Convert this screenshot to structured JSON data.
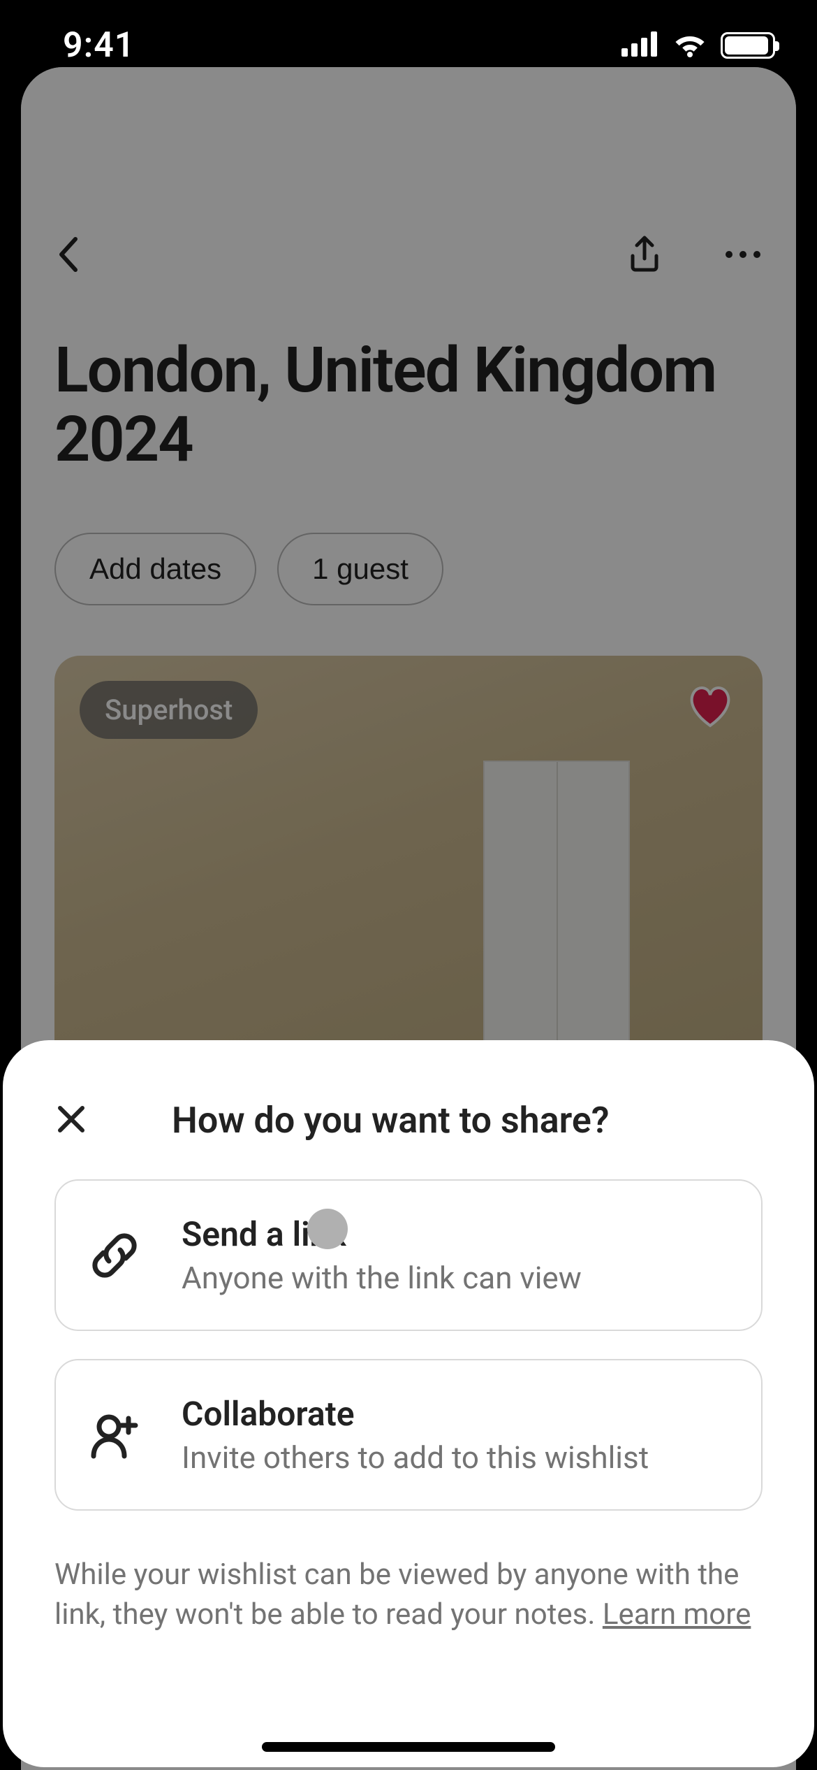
{
  "status": {
    "time": "9:41"
  },
  "page": {
    "title": "London, United Kingdom 2024",
    "dates_pill": "Add dates",
    "guests_pill": "1 guest",
    "listing_badge": "Superhost"
  },
  "sheet": {
    "title": "How do you want to share?",
    "options": [
      {
        "title": "Send a link",
        "subtitle": "Anyone with the link can view"
      },
      {
        "title": "Collaborate",
        "subtitle": "Invite others to add to this wishlist"
      }
    ],
    "disclaimer_prefix": "While your wishlist can be viewed by anyone with the link, they won't be able to read your notes. ",
    "learn_more": "Learn more"
  }
}
